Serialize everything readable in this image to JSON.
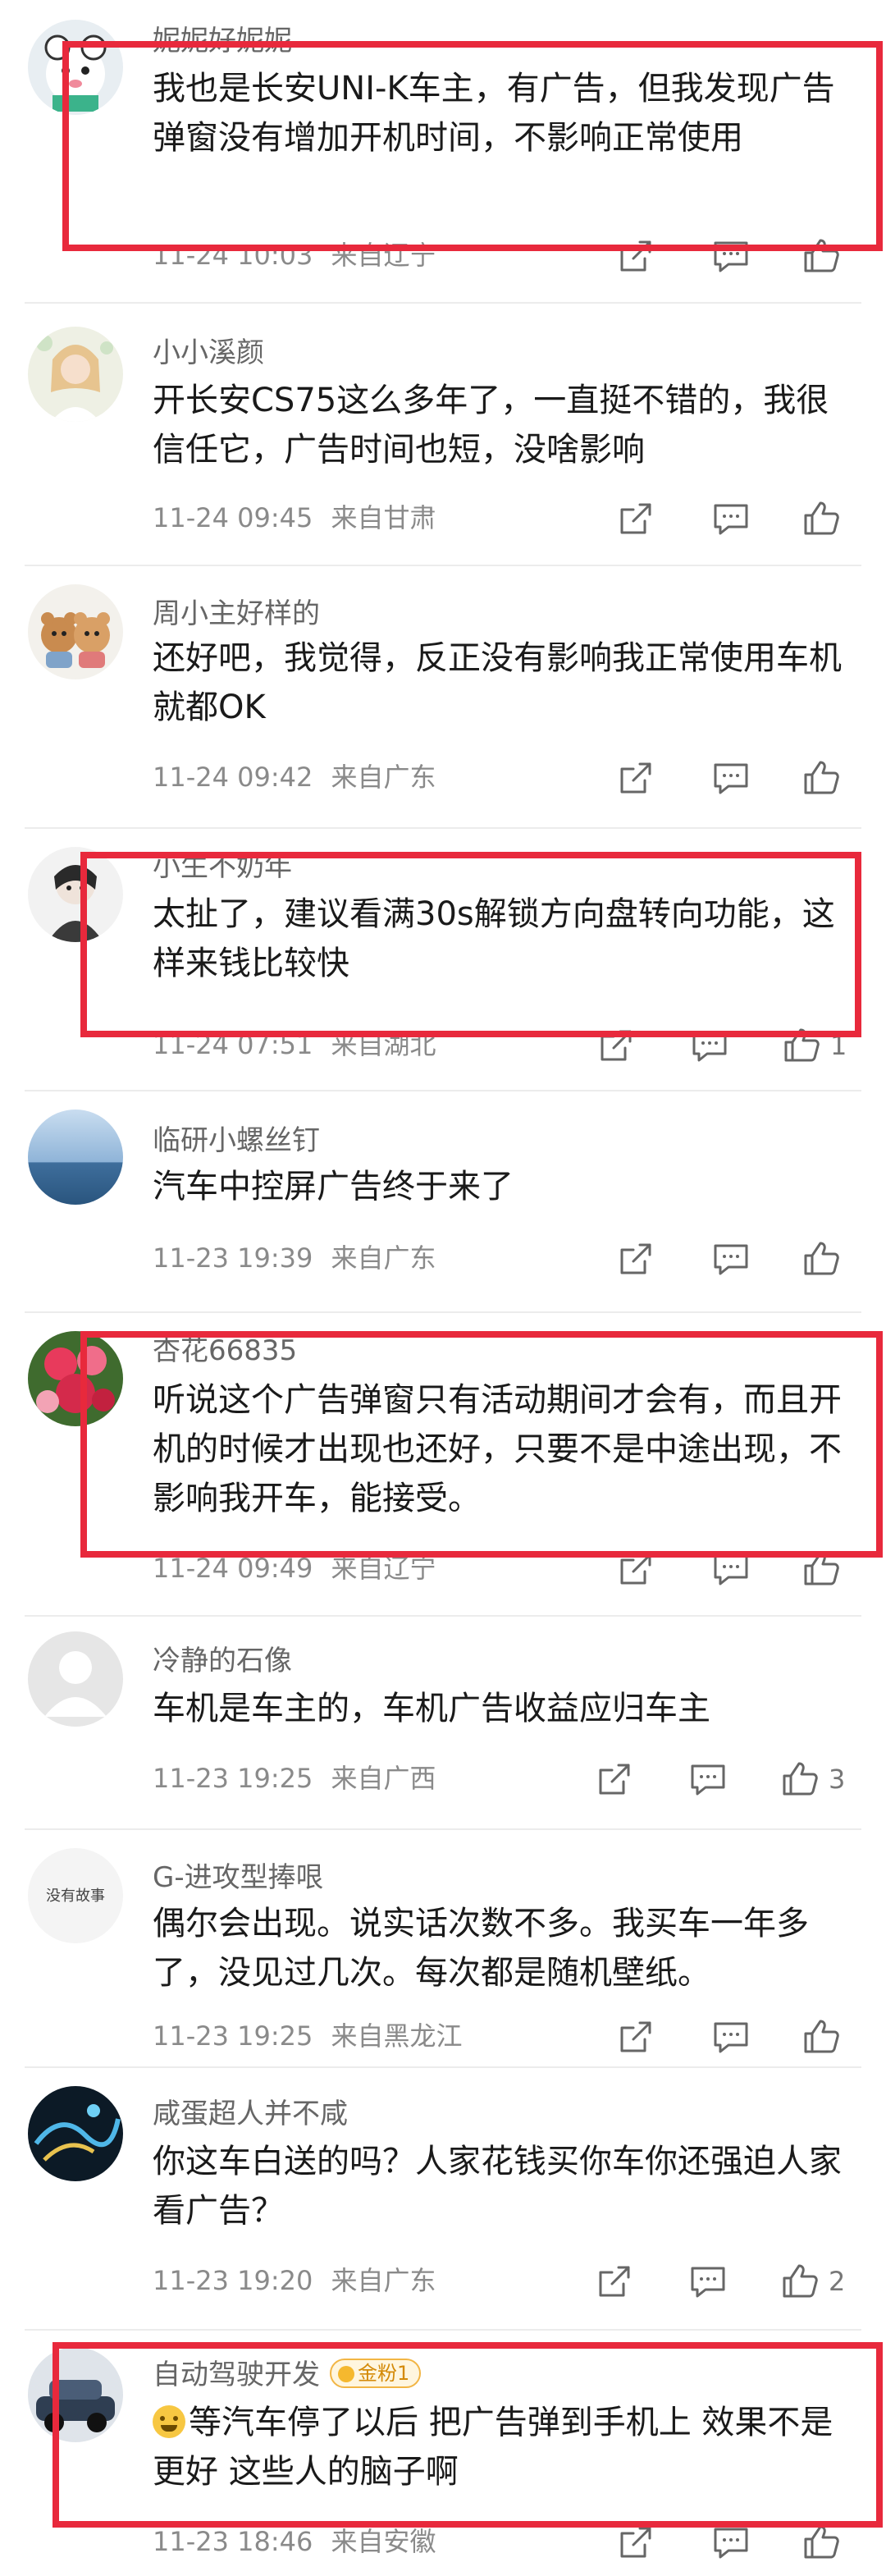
{
  "comments": [
    {
      "user": "妮妮好妮妮",
      "text": "我也是长安UNI-K车主，有广告，但我发现广告弹窗没有增加开机时间，不影响正常使用",
      "time": "11-24 10:03",
      "location": "来自辽宁",
      "likes": "",
      "highlighted": true
    },
    {
      "user": "小小溪颜",
      "text": "开长安CS75这么多年了，一直挺不错的，我很信任它，广告时间也短，没啥影响",
      "time": "11-24 09:45",
      "location": "来自甘肃",
      "likes": "",
      "highlighted": false
    },
    {
      "user": "周小主好样的",
      "text": "还好吧，我觉得，反正没有影响我正常使用车机就都OK",
      "time": "11-24 09:42",
      "location": "来自广东",
      "likes": "",
      "highlighted": false
    },
    {
      "user": "小生不奶年",
      "text": "太扯了，建议看满30s解锁方向盘转向功能，这样来钱比较快",
      "time": "11-24 07:51",
      "location": "来自湖北",
      "likes": "1",
      "highlighted": true
    },
    {
      "user": "临研小螺丝钉",
      "text": "汽车中控屏广告终于来了",
      "time": "11-23 19:39",
      "location": "来自广东",
      "likes": "",
      "highlighted": false
    },
    {
      "user": "杏花66835",
      "text": "听说这个广告弹窗只有活动期间才会有，而且开机的时候才出现也还好，只要不是中途出现，不影响我开车，能接受。",
      "time": "11-24 09:49",
      "location": "来自辽宁",
      "likes": "",
      "highlighted": true
    },
    {
      "user": "冷静的石像",
      "text": "车机是车主的，车机广告收益应归车主",
      "time": "11-23 19:25",
      "location": "来自广西",
      "likes": "3",
      "highlighted": false
    },
    {
      "user": "G-进攻型捧哏",
      "text": "偶尔会出现。说实话次数不多。我买车一年多了，没见过几次。每次都是随机壁纸。",
      "time": "11-23 19:25",
      "location": "来自黑龙江",
      "likes": "",
      "highlighted": false
    },
    {
      "user": "咸蛋超人并不咸",
      "text": "你这车白送的吗？人家花钱买你车你还强迫人家看广告？",
      "time": "11-23 19:20",
      "location": "来自广东",
      "likes": "2",
      "highlighted": false
    },
    {
      "user": "自动驾驶开发",
      "badge": "金粉1",
      "text": "等汽车停了以后 把广告弹到手机上 效果不是更好 这些人的脑子啊",
      "time": "11-23 18:46",
      "location": "来自安徽",
      "likes": "",
      "highlighted": true
    }
  ],
  "avatars_text": {
    "g_jingong": "没有故事"
  },
  "icons": {
    "share": "share-icon",
    "comment": "comment-icon",
    "like": "like-icon"
  },
  "colors": {
    "highlight": "#e8293c",
    "badge": "#f2b544"
  }
}
